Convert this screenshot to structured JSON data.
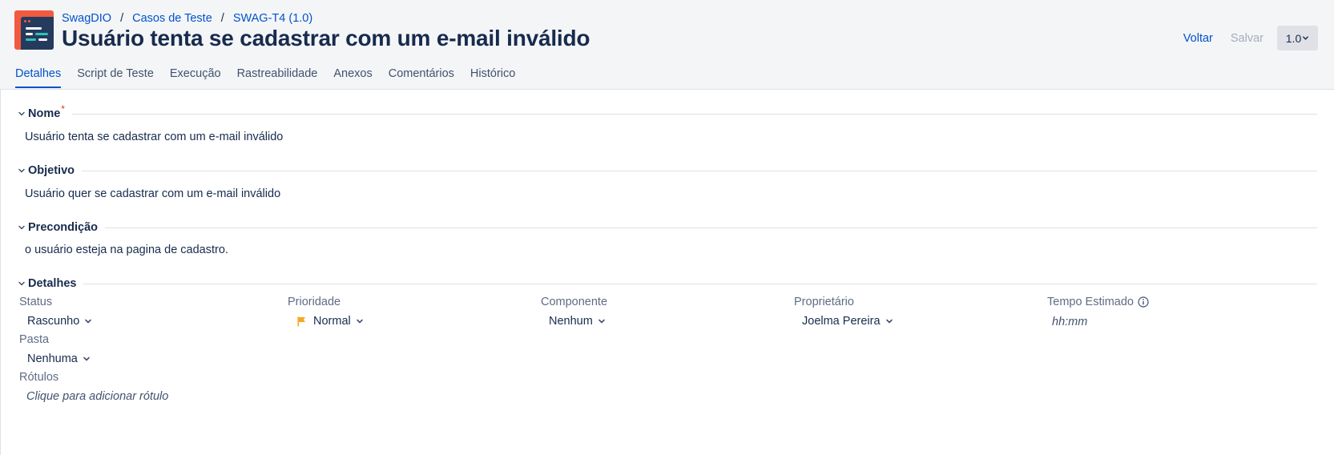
{
  "breadcrumb": [
    "SwagDIO",
    "Casos de Teste",
    "SWAG-T4 (1.0)"
  ],
  "title": "Usuário tenta se cadastrar com um e-mail inválido",
  "actions": {
    "back": "Voltar",
    "save": "Salvar",
    "version": "1.0"
  },
  "tabs": [
    "Detalhes",
    "Script de Teste",
    "Execução",
    "Rastreabilidade",
    "Anexos",
    "Comentários",
    "Histórico"
  ],
  "sections": {
    "name": {
      "label": "Nome",
      "required_mark": "*",
      "value": "Usuário tenta se cadastrar com um e-mail inválido"
    },
    "objective": {
      "label": "Objetivo",
      "value": "Usuário quer se cadastrar com um e-mail inválido"
    },
    "precondition": {
      "label": "Precondição",
      "value": "o usuário esteja na pagina de cadastro."
    },
    "details": {
      "label": "Detalhes"
    }
  },
  "fields": {
    "status": {
      "label": "Status",
      "value": "Rascunho"
    },
    "priority": {
      "label": "Prioridade",
      "value": "Normal"
    },
    "component": {
      "label": "Componente",
      "value": "Nenhum"
    },
    "owner": {
      "label": "Proprietário",
      "value": "Joelma Pereira"
    },
    "estimate": {
      "label": "Tempo Estimado",
      "placeholder": "hh:mm"
    },
    "folder": {
      "label": "Pasta",
      "value": "Nenhuma"
    },
    "labels": {
      "label": "Rótulos",
      "placeholder": "Clique para adicionar rótulo"
    }
  },
  "colors": {
    "accent": "#0052cc",
    "brand": "#f15a40",
    "flag": "#f6a623",
    "required": "#de350b"
  },
  "icons": [
    "app-logo-icon",
    "chevron-down-icon",
    "flag-icon",
    "info-icon"
  ]
}
